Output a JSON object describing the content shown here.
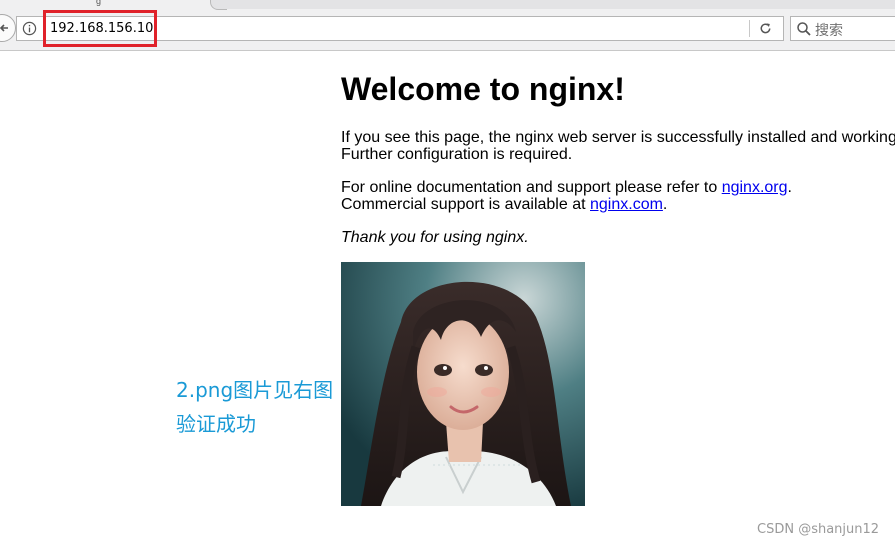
{
  "browser": {
    "url": "192.168.156.10",
    "search_placeholder": "搜索"
  },
  "page": {
    "heading": "Welcome to nginx!",
    "para1_line1": "If you see this page, the nginx web server is successfully installed and working.",
    "para1_line2": "Further configuration is required.",
    "para2_line1_prefix": "For online documentation and support please refer to ",
    "link_org": "nginx.org",
    "para2_line1_suffix": ".",
    "para2_line2_prefix": "Commercial support is available at ",
    "link_com": "nginx.com",
    "para2_line2_suffix": ".",
    "thanks": "Thank you for using nginx."
  },
  "annotation": {
    "line1": "2.png图片见右图",
    "line2": "验证成功"
  },
  "watermark": "CSDN @shanjun12",
  "colors": {
    "highlight_box": "#e0222a",
    "annotation_text": "#1a9ad6",
    "link": "#0000ee"
  }
}
